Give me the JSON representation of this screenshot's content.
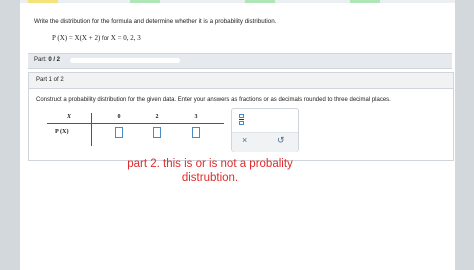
{
  "problem": {
    "instruction": "Write the distribution for the formula and determine whether it is a probability distribution.",
    "formula": {
      "lhs": "P (X) = X(X + 2)",
      "for_word": "for",
      "rhs": "X = 0, 2, 3"
    }
  },
  "progress": {
    "part_label": "Part:",
    "part_value": "0 / 2",
    "fraction": 0
  },
  "part_panel": {
    "title": "Part 1 of 2",
    "instructions": "Construct a probability distribution for the given data. Enter your answers as fractions or as decimals rounded to three decimal places."
  },
  "table": {
    "x_header": "X",
    "columns": [
      "0",
      "2",
      "3"
    ],
    "row_label": "P (X)",
    "answers": [
      "",
      "",
      ""
    ]
  },
  "tools": {
    "fraction_icon": "fraction-icon",
    "clear_symbol": "×",
    "undo_symbol": "↺"
  },
  "annotation": {
    "line1": "part 2. this is or is not a probality",
    "line2": "distrubtion."
  },
  "colors": {
    "accent": "#4a8ac4",
    "annotation": "#e02a2a",
    "sidebar": "#d3d8dd",
    "header_bg": "#e6eaee"
  }
}
